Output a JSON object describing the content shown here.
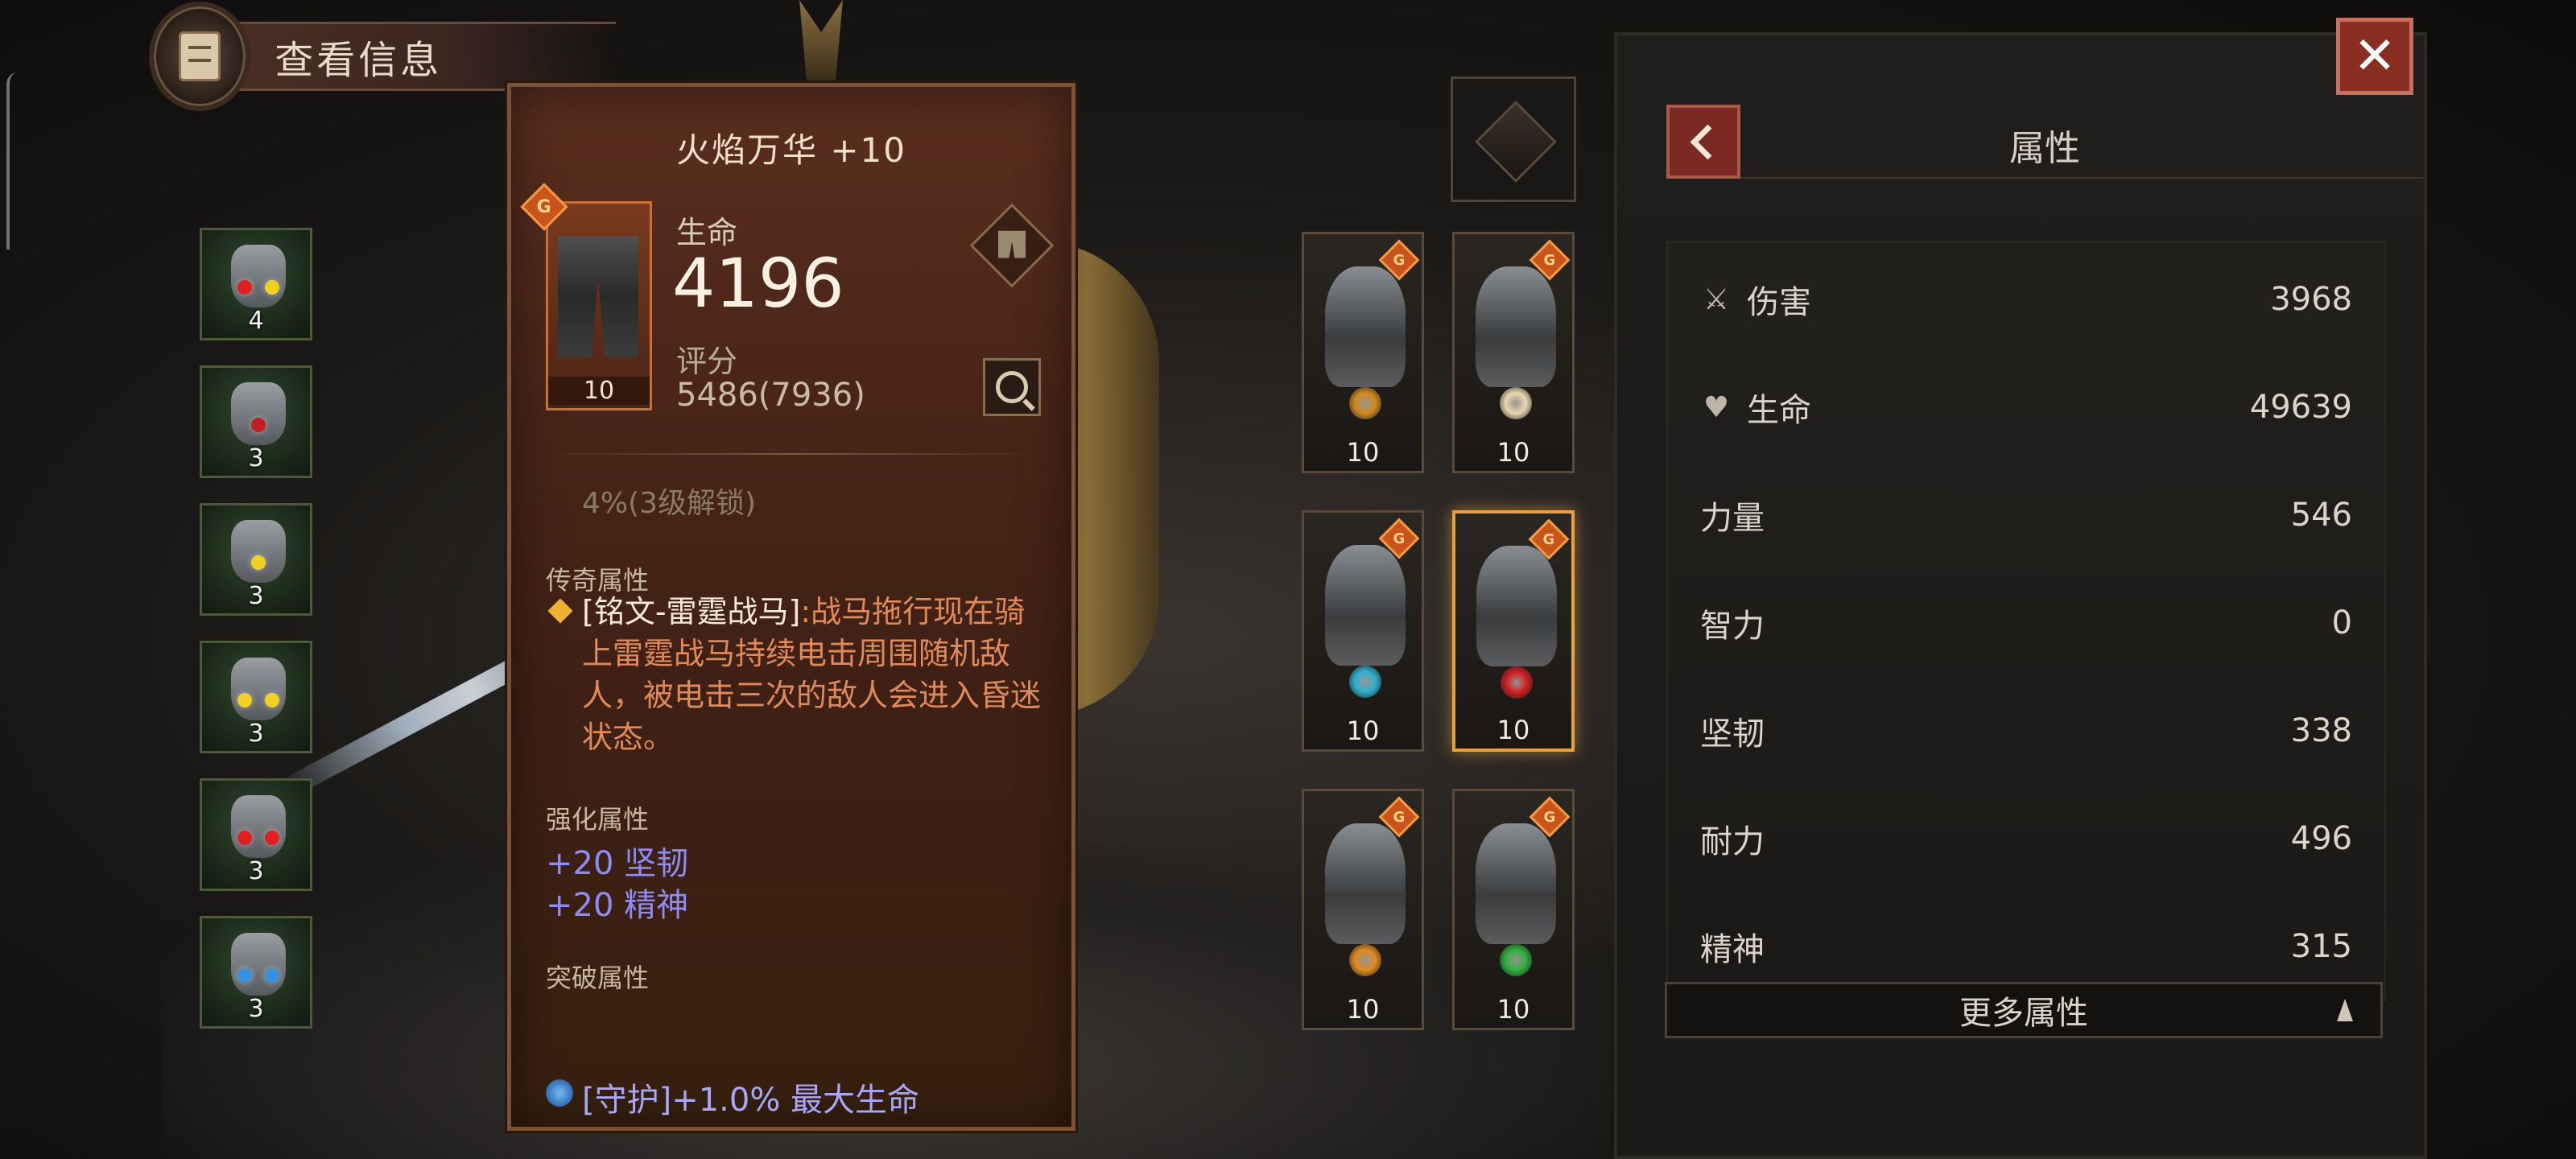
{
  "header": {
    "title": "查看信息"
  },
  "gems": [
    {
      "count": "4",
      "dots": [
        "#e02020",
        "#f0d020"
      ]
    },
    {
      "count": "3",
      "dots": [
        "#c02020"
      ]
    },
    {
      "count": "3",
      "dots": [
        "#f0d020"
      ]
    },
    {
      "count": "3",
      "dots": [
        "#f0d020",
        "#f0d020"
      ]
    },
    {
      "count": "3",
      "dots": [
        "#e02020",
        "#e02020"
      ]
    },
    {
      "count": "3",
      "dots": [
        "#3a90e0",
        "#3a90e0"
      ]
    }
  ],
  "item": {
    "name": "火焰万华 +10",
    "level": "10",
    "life_label": "生命",
    "life_value": "4196",
    "score_label": "评分",
    "score_value": "5486(7936)",
    "locked_text": "4%(3级解锁)",
    "legendary_label": "传奇属性",
    "legendary_keyword": "[铭文-雷霆战马]",
    "legendary_desc": ":战马拖行现在骑上雷霆战马持续电击周围随机敌人，被电击三次的敌人会进入昏迷状态。",
    "enhance_label": "强化属性",
    "enhance_lines": [
      "+20 坚韧",
      "+20 精神"
    ],
    "breakthrough_label": "突破属性",
    "breakthrough_line": "[守护]+1.0% 最大生命"
  },
  "equipment": [
    {
      "slot": "helm",
      "level": "10",
      "gem": "#d08a20"
    },
    {
      "slot": "chest",
      "level": "10",
      "gem": "#e8d8b0"
    },
    {
      "slot": "gloves",
      "level": "10",
      "gem": "#30b0d0"
    },
    {
      "slot": "legs",
      "level": "10",
      "gem": "#d02020",
      "selected": true
    },
    {
      "slot": "neck",
      "level": "10",
      "gem": "#e08a20"
    },
    {
      "slot": "shoulders",
      "level": "10",
      "gem": "#30b040"
    }
  ],
  "attributes": {
    "title": "属性",
    "rows": [
      {
        "icon": "⚔",
        "label": "伤害",
        "value": "3968"
      },
      {
        "icon": "♥",
        "label": "生命",
        "value": "49639"
      },
      {
        "icon": "",
        "label": "力量",
        "value": "546"
      },
      {
        "icon": "",
        "label": "智力",
        "value": "0"
      },
      {
        "icon": "",
        "label": "坚韧",
        "value": "338"
      },
      {
        "icon": "",
        "label": "耐力",
        "value": "496"
      },
      {
        "icon": "",
        "label": "精神",
        "value": "315"
      }
    ],
    "more_label": "更多属性"
  },
  "close_label": "✕",
  "legend_mark": "G"
}
